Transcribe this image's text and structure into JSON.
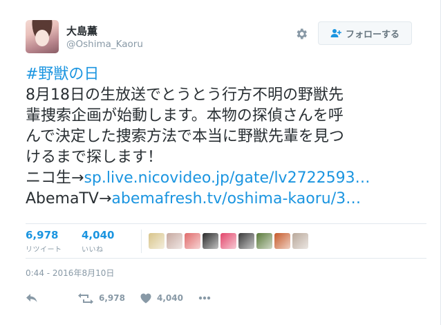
{
  "user": {
    "display_name": "大島薫",
    "screen_name": "@Oshima_Kaoru"
  },
  "follow_button": {
    "label": "フォローする"
  },
  "tweet": {
    "hashtag": "#野獣の日",
    "lines": [
      "8月18日の生放送でとうとう行方不明の野獣先",
      "輩捜索企画が始動します。本物の探偵さんを呼",
      "んで決定した捜索方法で本当に野獣先輩を見つ",
      "けるまで探します！"
    ],
    "link1_prefix": "ニコ生→",
    "link1_text": "sp.live.nicovideo.jp/gate/lv2722593…",
    "link2_prefix": "AbemaTV→",
    "link2_text": "abemafresh.tv/oshima-kaoru/3…"
  },
  "stats": {
    "retweets_value": "6,978",
    "retweets_label": "リツイート",
    "likes_value": "4,040",
    "likes_label": "いいね"
  },
  "likers": [
    {
      "icon": "liker-avatar-1",
      "color": "#d8c48a"
    },
    {
      "icon": "liker-avatar-2",
      "color": "#c7a9a0"
    },
    {
      "icon": "liker-avatar-3",
      "color": "#e06a6a"
    },
    {
      "icon": "liker-avatar-4",
      "color": "#2a2a2a"
    },
    {
      "icon": "liker-avatar-5",
      "color": "#e2456a"
    },
    {
      "icon": "liker-avatar-6",
      "color": "#3a3a3a"
    },
    {
      "icon": "liker-avatar-7",
      "color": "#5a7a3a"
    },
    {
      "icon": "liker-avatar-8",
      "color": "#c65a2a"
    },
    {
      "icon": "liker-avatar-9",
      "color": "#b9a89a"
    }
  ],
  "timestamp": "0:44 - 2016年8月10日",
  "actions": {
    "retweet_count": "6,978",
    "like_count": "4,040"
  },
  "colors": {
    "link": "#1b95e0",
    "muted": "#8899a6",
    "text": "#292f33",
    "border": "#e1e8ed"
  }
}
